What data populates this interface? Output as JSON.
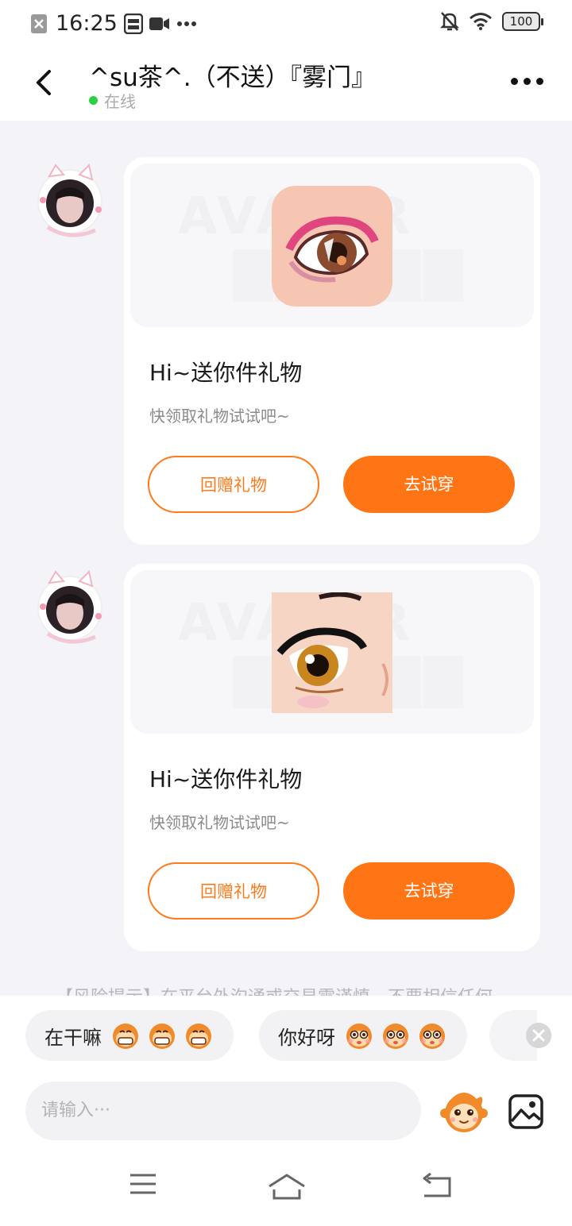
{
  "status_bar": {
    "time": "16:25",
    "battery": "100"
  },
  "header": {
    "title": "^su茶^.（不送）『雾门』",
    "online_status": "在线"
  },
  "messages": [
    {
      "title": "Hi~送你件礼物",
      "subtitle": "快领取礼物试试吧~",
      "return_gift_label": "回赠礼物",
      "try_on_label": "去试穿",
      "watermark": "AVATAR"
    },
    {
      "title": "Hi~送你件礼物",
      "subtitle": "快领取礼物试试吧~",
      "return_gift_label": "回赠礼物",
      "try_on_label": "去试穿",
      "watermark": "AVATAR"
    }
  ],
  "risk_notice": "【风险提示】在平台外沟通或交易需谨慎，不要相信任何",
  "quick_replies": [
    {
      "text": "在干嘛",
      "emoji_count": 3,
      "emoji": "grin-monkey-icon"
    },
    {
      "text": "你好呀",
      "emoji_count": 3,
      "emoji": "shy-monkey-icon"
    }
  ],
  "input": {
    "placeholder": "请输入···"
  },
  "colors": {
    "accent": "#ff7414",
    "online": "#2fcf44"
  }
}
